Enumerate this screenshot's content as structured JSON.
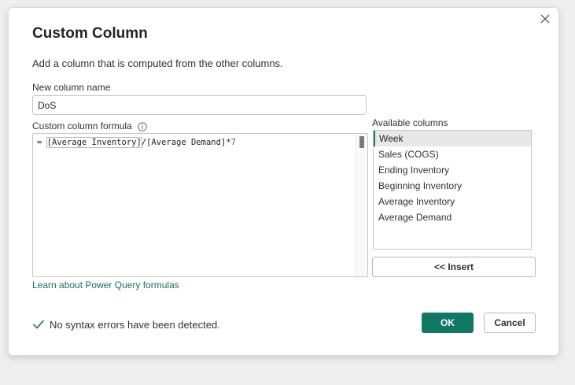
{
  "dialog": {
    "title": "Custom Column",
    "subtitle": "Add a column that is computed from the other columns.",
    "close_icon": "close-icon"
  },
  "new_column": {
    "label": "New column name",
    "value": "DoS"
  },
  "formula": {
    "label": "Custom column formula",
    "info_icon": "info-icon",
    "prefix": "= ",
    "bracket_part": "[Average Inventory]",
    "middle": "/[Average Demand]*",
    "number": "7"
  },
  "available_columns": {
    "label": "Available columns",
    "items": [
      "Week",
      "Sales (COGS)",
      "Ending Inventory",
      "Beginning Inventory",
      "Average Inventory",
      "Average Demand"
    ],
    "selected_index": 0,
    "insert_label": "<< Insert"
  },
  "learn_link": "Learn about Power Query formulas",
  "status": {
    "icon": "check-icon",
    "text": "No syntax errors have been detected.",
    "color": "#2e8b57"
  },
  "buttons": {
    "ok": "OK",
    "cancel": "Cancel",
    "accent_color": "#117865"
  }
}
